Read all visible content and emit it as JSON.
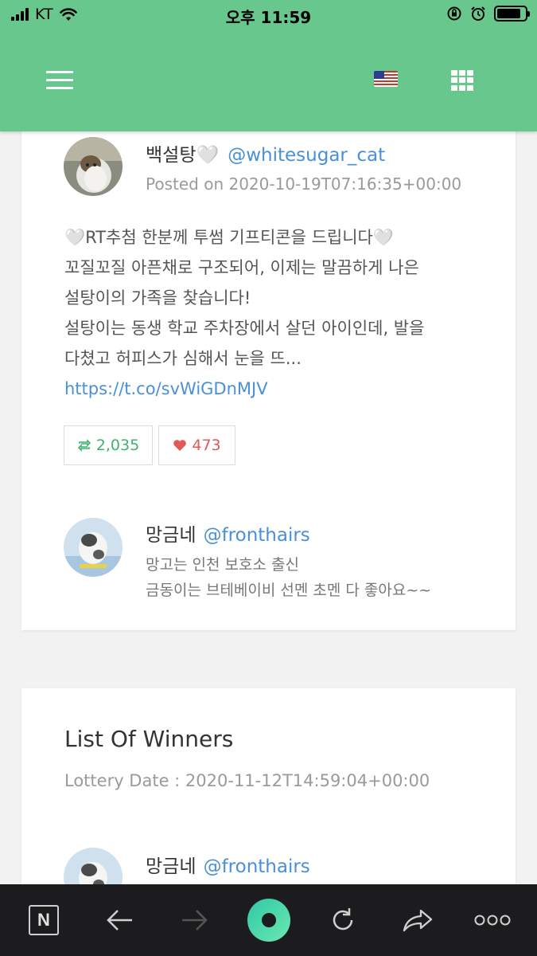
{
  "status_bar": {
    "carrier": "KT",
    "time": "오후 11:59",
    "battery_level": 0.85
  },
  "app_header": {
    "menu_icon": "hamburger-icon",
    "language_icon": "us-flag-icon",
    "apps_icon": "grid-icon",
    "color": "#67c78d"
  },
  "tweet": {
    "author_name": "백설탕🤍",
    "author_handle": "@whitesugar_cat",
    "posted": "Posted on 2020-10-19T07:16:35+00:00",
    "text_lines": [
      "🤍RT추첨 한분께 투썸 기프티콘을 드립니다🤍",
      "꼬질꼬질 아픈채로 구조되어, 이제는 말끔하게 나은",
      "설탕이의 가족을 찾습니다!",
      "설탕이는 동생 학교 주차장에서 살던 아이인데, 발을",
      "다쳤고 허피스가 심해서 눈을 뜨..."
    ],
    "link": "https://t.co/svWiGDnMJV",
    "retweets": "2,035",
    "likes": "473",
    "retweet_color": "#3cb371",
    "like_color": "#e05a5a"
  },
  "host": {
    "name": "망금네",
    "handle": "@fronthairs",
    "bio_lines": [
      "망고는 인천 보호소 출신",
      "금동이는 브테베이비 선멘 초멘 다 좋아요~~"
    ]
  },
  "winners": {
    "title": "List Of Winners",
    "lottery_date": "Lottery Date : 2020-11-12T14:59:04+00:00",
    "entries": [
      {
        "name": "망금네",
        "handle": "@fronthairs"
      }
    ]
  },
  "toolbar": {
    "items": [
      "n-logo-icon",
      "back-arrow-icon",
      "forward-arrow-icon",
      "home-icon",
      "reload-icon",
      "share-icon",
      "more-icon"
    ]
  }
}
